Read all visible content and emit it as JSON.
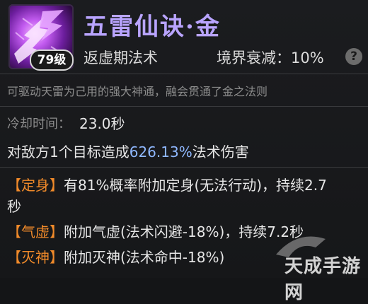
{
  "skill": {
    "name": "五雷仙诀·金",
    "level_badge": "79级",
    "realm": "返虚期法术",
    "decay_label": "境界衰减：",
    "decay_value": "10%",
    "help_symbol": "?",
    "description": "可驱动天雷为己用的强大神通，融会贯通了金之法则"
  },
  "stats": {
    "cooldown_label": "冷却时间：",
    "cooldown_value": "23.0秒",
    "damage_prefix": "对敌方1个目标造成",
    "damage_value": "626.13%",
    "damage_suffix": "法术伤害"
  },
  "effects": [
    {
      "tag": "【定身】",
      "text_line1": "有81%概率附加定身(无法行动)，持续2.7",
      "text_line2": "秒"
    },
    {
      "tag": "【气虚】",
      "text_line1": "附加气虚(法术闪避-18%)，持续7.2秒"
    },
    {
      "tag": "【灭神】",
      "text_line1": "附加灭神(法术命中-18%)"
    }
  ],
  "watermark": {
    "text": "天成手游网"
  },
  "colors": {
    "title": "#b9a4ff",
    "tag": "#f08a2a",
    "damage_value": "#8fb8ff",
    "muted": "#8d8d8d",
    "background": "#161719"
  }
}
